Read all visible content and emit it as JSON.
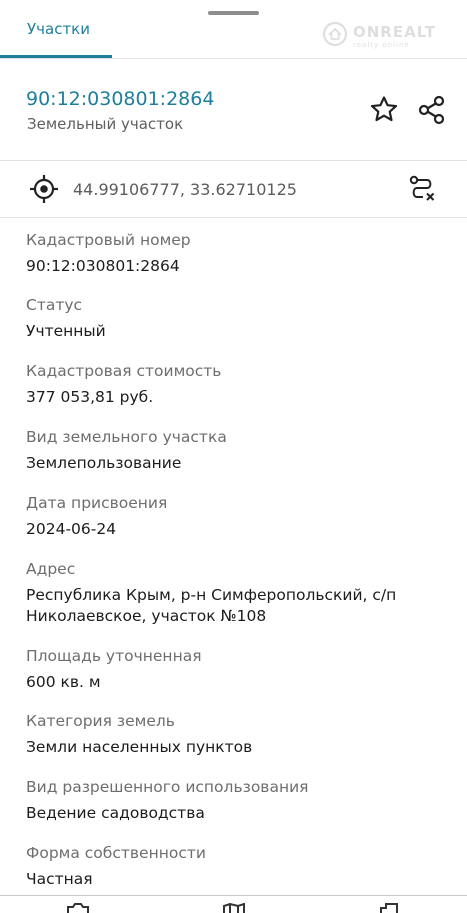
{
  "tabs": {
    "active_label": "Участки"
  },
  "watermark": {
    "brand": "ONREALT",
    "sub": "realty online"
  },
  "header": {
    "cadastral_number": "90:12:030801:2864",
    "object_type": "Земельный участок"
  },
  "icons": {
    "favorite": "star-icon",
    "share": "share-icon",
    "location": "crosshair-location-icon",
    "route": "route-icon"
  },
  "coordinates": {
    "text": "44.99106777, 33.62710125"
  },
  "fields": [
    {
      "label": "Кадастровый номер",
      "value": "90:12:030801:2864"
    },
    {
      "label": "Статус",
      "value": "Учтенный"
    },
    {
      "label": "Кадастровая стоимость",
      "value": "377 053,81 руб."
    },
    {
      "label": "Вид земельного участка",
      "value": "Землепользование"
    },
    {
      "label": "Дата присвоения",
      "value": "2024-06-24"
    },
    {
      "label": "Адрес",
      "value": "Республика Крым, р-н Симферопольский, с/п Николаевское, участок №108"
    },
    {
      "label": "Площадь уточненная",
      "value": "600 кв. м"
    },
    {
      "label": "Категория земель",
      "value": "Земли населенных пунктов"
    },
    {
      "label": "Вид разрешенного использования",
      "value": "Ведение садоводства"
    },
    {
      "label": "Форма собственности",
      "value": "Частная"
    }
  ],
  "colors": {
    "accent": "#1e7f9c",
    "label": "#6e6e6e",
    "value": "#1c1c1c",
    "divider": "#e2e2e2"
  }
}
